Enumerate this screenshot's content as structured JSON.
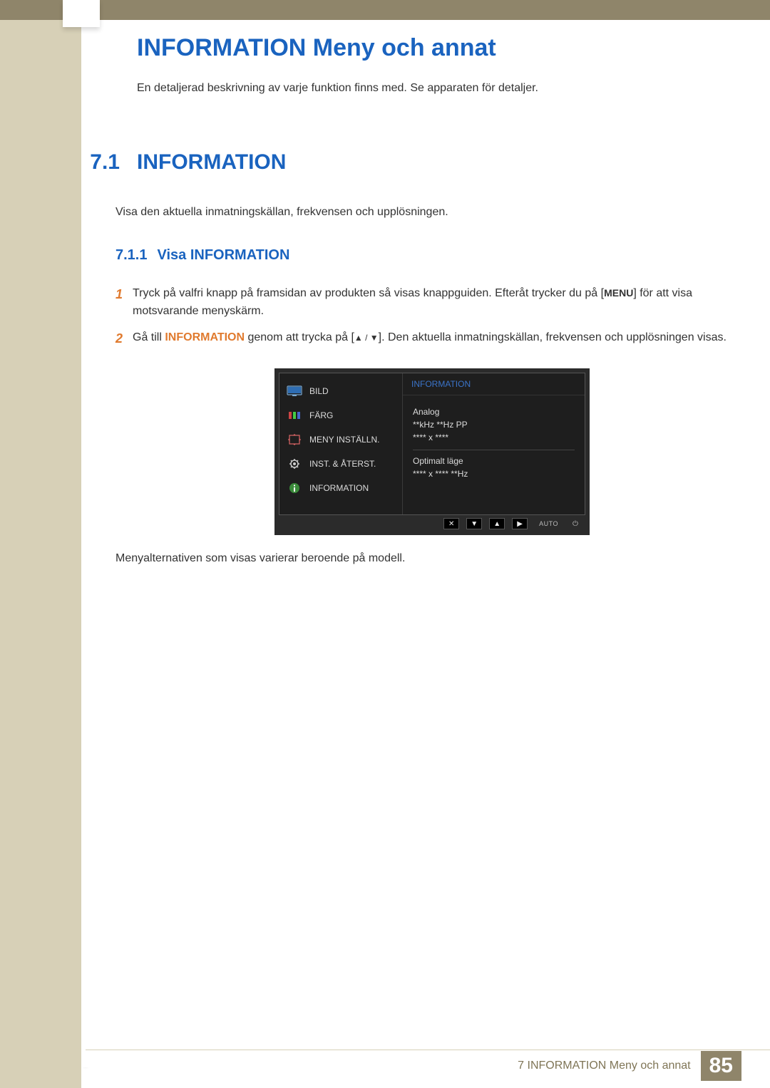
{
  "chapter": {
    "title": "INFORMATION Meny och annat",
    "intro": "En detaljerad beskrivning av varje funktion finns med. Se apparaten för detaljer."
  },
  "section": {
    "num": "7.1",
    "title": "INFORMATION",
    "desc": "Visa den aktuella inmatningskällan, frekvensen och upplösningen."
  },
  "subsection": {
    "num": "7.1.1",
    "title": "Visa INFORMATION"
  },
  "steps": {
    "s1": {
      "num": "1",
      "a": "Tryck på valfri knapp på framsidan av produkten så visas knappguiden. Efteråt trycker du på [",
      "menu": "MENU",
      "b": "] för att visa motsvarande menyskärm."
    },
    "s2": {
      "num": "2",
      "a": "Gå till ",
      "kw": "INFORMATION",
      "b": " genom att trycka på [",
      "c": "]. Den aktuella inmatningskällan, frekvensen och upplösningen visas."
    }
  },
  "osd": {
    "menu": {
      "m1": "BILD",
      "m2": "FÄRG",
      "m3": "MENY INSTÄLLN.",
      "m4": "INST. & ÅTERST.",
      "m5": "INFORMATION"
    },
    "panel": {
      "title": "INFORMATION",
      "l1": "Analog",
      "l2": "**kHz  **Hz PP",
      "l3": "**** x ****",
      "l4": "Optimalt läge",
      "l5": "**** x ****  **Hz"
    },
    "btn_auto": "AUTO"
  },
  "caption": "Menyalternativen som visas varierar beroende på modell.",
  "footer": {
    "text": "7 INFORMATION Meny och annat",
    "page": "85"
  }
}
